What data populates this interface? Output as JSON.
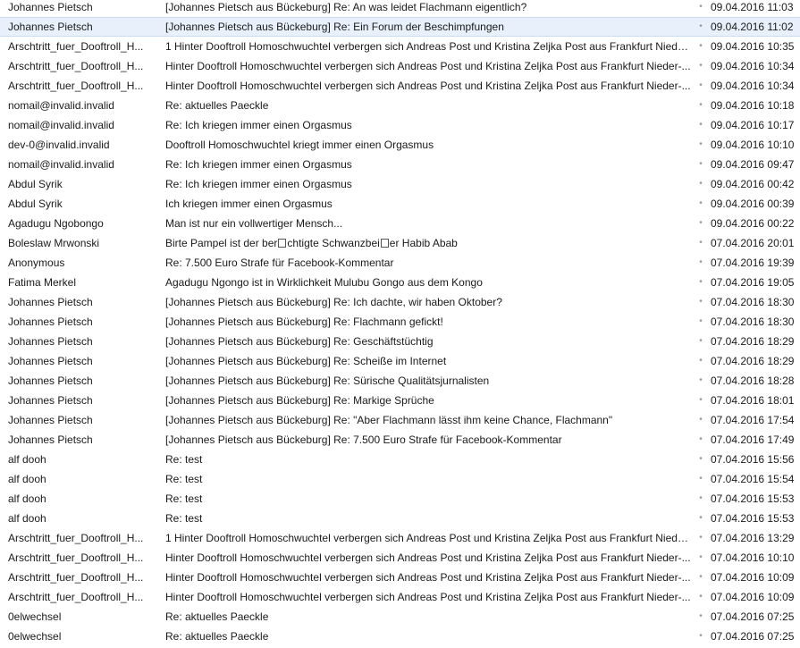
{
  "list": {
    "dot_glyph": "•",
    "rows": [
      {
        "from": "Johannes Pietsch",
        "subject": "[Johannes Pietsch aus Bückeburg]  Re: An was leidet Flachmann eigentlich?",
        "date": "09.04.2016 11:03",
        "selected": false
      },
      {
        "from": "Johannes Pietsch",
        "subject": "[Johannes Pietsch aus Bückeburg]  Re: Ein Forum der Beschimpfungen",
        "date": "09.04.2016 11:02",
        "selected": true
      },
      {
        "from": "Arschtritt_fuer_Dooftroll_H...",
        "subject": "1 Hinter Dooftroll Homoschwuchtel verbergen sich Andreas Post und Kristina Zeljka Post aus Frankfurt Nieder...",
        "date": "09.04.2016 10:35",
        "selected": false
      },
      {
        "from": "Arschtritt_fuer_Dooftroll_H...",
        "subject": "Hinter Dooftroll Homoschwuchtel verbergen sich Andreas Post und Kristina Zeljka Post aus Frankfurt Nieder-...",
        "date": "09.04.2016 10:34",
        "selected": false
      },
      {
        "from": "Arschtritt_fuer_Dooftroll_H...",
        "subject": "Hinter Dooftroll Homoschwuchtel verbergen sich Andreas Post und Kristina Zeljka Post aus Frankfurt Nieder-...",
        "date": "09.04.2016 10:34",
        "selected": false
      },
      {
        "from": "nomail@invalid.invalid",
        "subject": "Re: aktuelles Paeckle",
        "date": "09.04.2016 10:18",
        "selected": false
      },
      {
        "from": "nomail@invalid.invalid",
        "subject": "Re: Ich kriegen immer einen Orgasmus",
        "date": "09.04.2016 10:17",
        "selected": false
      },
      {
        "from": "dev-0@invalid.invalid",
        "subject": "Dooftroll Homoschwuchtel kriegt immer einen Orgasmus",
        "date": "09.04.2016 10:10",
        "selected": false
      },
      {
        "from": "nomail@invalid.invalid",
        "subject": "Re: Ich kriegen immer einen Orgasmus",
        "date": "09.04.2016 09:47",
        "selected": false
      },
      {
        "from": "Abdul Syrik",
        "subject": "Re: Ich kriegen immer einen Orgasmus",
        "date": "09.04.2016 00:42",
        "selected": false
      },
      {
        "from": "Abdul Syrik",
        "subject": "Ich kriegen immer einen Orgasmus",
        "date": "09.04.2016 00:39",
        "selected": false
      },
      {
        "from": "Agadugu Ngobongo",
        "subject": "Man ist nur ein vollwertiger Mensch...",
        "date": "09.04.2016 00:22",
        "selected": false
      },
      {
        "from": "Boleslaw Mrwonski",
        "subject_parts": [
          "Birte Pampel ist der ber",
          "chtigte Schwanzbei",
          "er Habib Abab"
        ],
        "date": "07.04.2016 20:01",
        "selected": false
      },
      {
        "from": "Anonymous",
        "subject": "Re: 7.500 Euro Strafe für Facebook-Kommentar",
        "date": "07.04.2016 19:39",
        "selected": false
      },
      {
        "from": "Fatima Merkel",
        "subject": "Agadugu Ngongo ist in Wirklichkeit Mulubu Gongo aus dem Kongo",
        "date": "07.04.2016 19:05",
        "selected": false
      },
      {
        "from": "Johannes Pietsch",
        "subject": "[Johannes Pietsch aus Bückeburg]  Re: Ich dachte, wir haben Oktober?",
        "date": "07.04.2016 18:30",
        "selected": false
      },
      {
        "from": "Johannes Pietsch",
        "subject": "[Johannes Pietsch aus Bückeburg]  Re: Flachmann gefickt!",
        "date": "07.04.2016 18:30",
        "selected": false
      },
      {
        "from": "Johannes Pietsch",
        "subject": "[Johannes Pietsch aus Bückeburg]  Re: Geschäftstüchtig",
        "date": "07.04.2016 18:29",
        "selected": false
      },
      {
        "from": "Johannes Pietsch",
        "subject": "[Johannes Pietsch aus Bückeburg]  Re: Scheiße im Internet",
        "date": "07.04.2016 18:29",
        "selected": false
      },
      {
        "from": "Johannes Pietsch",
        "subject": "[Johannes Pietsch aus Bückeburg]  Re: Sürische Qualitätsjurnalisten",
        "date": "07.04.2016 18:28",
        "selected": false
      },
      {
        "from": "Johannes Pietsch",
        "subject": "[Johannes Pietsch aus Bückeburg] Re: Markige Sprüche",
        "date": "07.04.2016 18:01",
        "selected": false
      },
      {
        "from": "Johannes Pietsch",
        "subject": "[Johannes Pietsch aus Bückeburg]  Re: \"Aber Flachmann lässt ihm keine Chance, Flachmann\"",
        "date": "07.04.2016 17:54",
        "selected": false
      },
      {
        "from": "Johannes Pietsch",
        "subject": "[Johannes Pietsch aus Bückeburg]  Re: 7.500 Euro Strafe für Facebook-Kommentar",
        "date": "07.04.2016 17:49",
        "selected": false
      },
      {
        "from": "alf dooh",
        "subject": "Re: test",
        "date": "07.04.2016 15:56",
        "selected": false
      },
      {
        "from": "alf dooh",
        "subject": "Re: test",
        "date": "07.04.2016 15:54",
        "selected": false
      },
      {
        "from": "alf dooh",
        "subject": "Re: test",
        "date": "07.04.2016 15:53",
        "selected": false
      },
      {
        "from": "alf dooh",
        "subject": "Re: test",
        "date": "07.04.2016 15:53",
        "selected": false
      },
      {
        "from": "Arschtritt_fuer_Dooftroll_H...",
        "subject": "1 Hinter Dooftroll Homoschwuchtel verbergen sich Andreas Post und Kristina Zeljka Post aus Frankfurt Nieder...",
        "date": "07.04.2016 13:29",
        "selected": false
      },
      {
        "from": "Arschtritt_fuer_Dooftroll_H...",
        "subject": "Hinter Dooftroll Homoschwuchtel verbergen sich Andreas Post und Kristina Zeljka Post aus Frankfurt Nieder-...",
        "date": "07.04.2016 10:10",
        "selected": false
      },
      {
        "from": "Arschtritt_fuer_Dooftroll_H...",
        "subject": "Hinter Dooftroll Homoschwuchtel verbergen sich Andreas Post und Kristina Zeljka Post aus Frankfurt Nieder-...",
        "date": "07.04.2016 10:09",
        "selected": false
      },
      {
        "from": "Arschtritt_fuer_Dooftroll_H...",
        "subject": "Hinter Dooftroll Homoschwuchtel verbergen sich Andreas Post und Kristina Zeljka Post aus Frankfurt Nieder-...",
        "date": "07.04.2016 10:09",
        "selected": false
      },
      {
        "from": "0elwechsel",
        "subject": "Re: aktuelles Paeckle",
        "date": "07.04.2016 07:25",
        "selected": false
      },
      {
        "from": "0elwechsel",
        "subject": "Re: aktuelles Paeckle",
        "date": "07.04.2016 07:25",
        "selected": false
      }
    ]
  },
  "colors": {
    "selected_background": "#e8f1fb",
    "selected_border": "#c9dcf2",
    "text": "#1a1a1a",
    "dot": "#9a9a9a"
  }
}
